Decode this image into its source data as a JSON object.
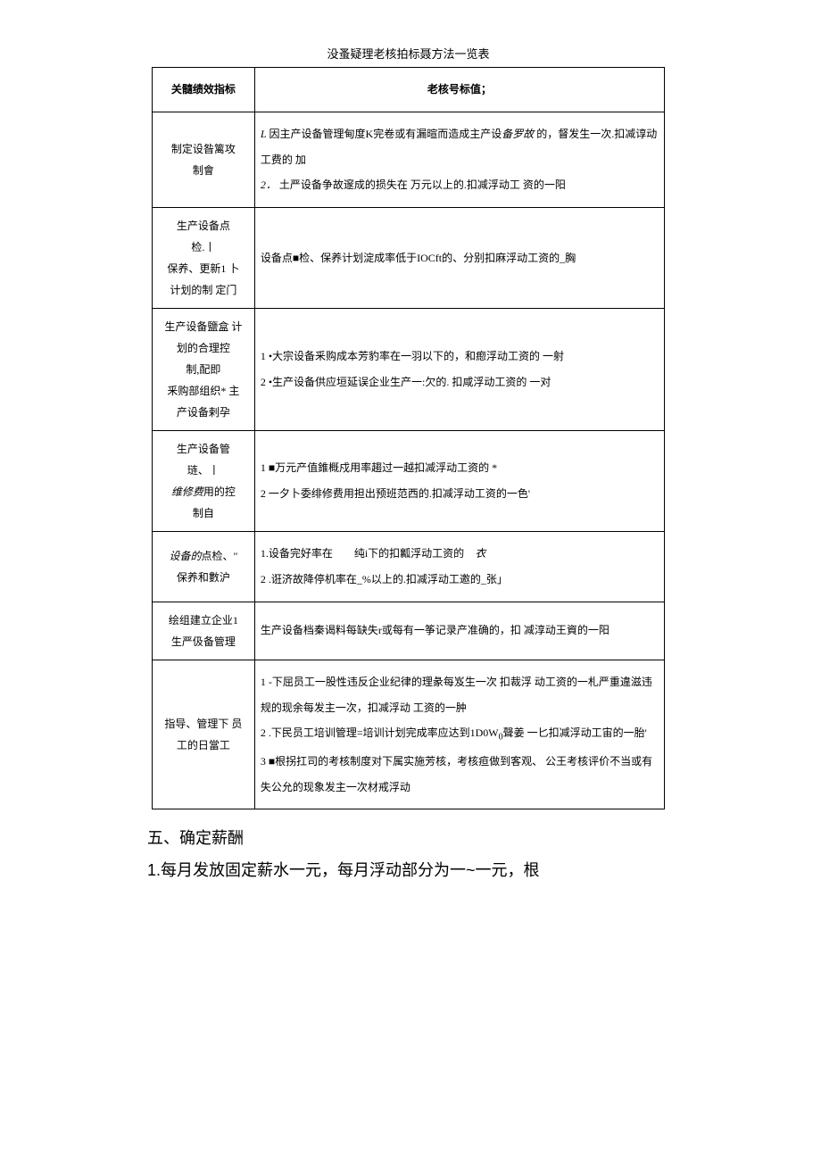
{
  "tableTitle": "没蚤疑理老核拍标聂方法一览表",
  "headers": {
    "col1": "关髓绩效指标",
    "col2": "老核号标值；"
  },
  "rows": [
    {
      "leftLines": [
        "制定设昝篱攻",
        "制會"
      ],
      "right": "<span class=\"italic\">L</span> 因主产设备管理甸度K完卷或有漏暄而造成主产设<span class=\"italic\">备罗故</span> 的，督发生一次.扣减谆动工费的 加<br><span class=\"italic\">2．</span> 土严设备争故邃成的损失在 万元以上的.扣减浮动工 资的一阳"
    },
    {
      "leftLines": [
        "生产设备点",
        "检.丨",
        "保养、更新1 卜",
        "计划的制 定门"
      ],
      "right": "设备点■检、保养计划淀成率低于IOCft的、分别扣麻浮动工资的_胸"
    },
    {
      "leftLines": [
        "生产设备鹽盒 计",
        "划的合理控",
        "制,配即",
        "釆购部组织* 主",
        "产设备剌孕"
      ],
      "right": "1 •大宗设备釆购成本芳豹率在一羽以下的，和瘛浮动工资的 一射<br>2 •生产设备供应垣延误企业生产一:欠的. 扣咸浮动工资的 一对"
    },
    {
      "leftLines": [
        "生产设备管",
        "琏、丨",
        "<span class=\"italic\">维修费</span>用的控",
        "制自"
      ],
      "right": "1 ■万元产值錐概戍用率趨过一越扣减浮动工资的 *<br>2 一夕卜委绯修费用担出预班范西的.扣减浮动工资的一色'"
    },
    {
      "leftLines": [
        "<span class=\"italic\">设备的</span>点检、\"",
        "保养和數沪"
      ],
      "right": "1.设备完好率在　　纯i下的扣瓤浮动工资的　<span class=\"italic\">衣</span><br>2 .诳济故降停机率在_%以上的.扣减浮动工邀的_张」"
    },
    {
      "leftLines": [
        "绘组建立企业1",
        "生严伋备管理"
      ],
      "right": "生产设备档秦谒料每缺失r或每有一筝记录产准确的，扣 减淳动王資的一阳"
    },
    {
      "leftLines": [
        "指导、管理下 员",
        "工的日當工"
      ],
      "right": "1 -下屈员工一股性违反企业纪律的理彖每岌生一次 扣裁浮 动工资的一札严重違滋违规的现余每发主一次，扣减浮动 工资的一肿<br>2 .下民员工培训管理=培训计划完成率应达到1D0W<sub>0</sub>聲姜 一匕扣减浮动工宙的一胎'<br>3 ■根拐扛司的考核制度对下属实施芳核，考核疸做到客观、 公王考核评价不当或有失公允的现象发主一次材戒浮动"
    }
  ],
  "heading": "五、确定薪酬",
  "bodyText": "1.每月发放固定薪水一元，每月浮动部分为一~一元，根"
}
